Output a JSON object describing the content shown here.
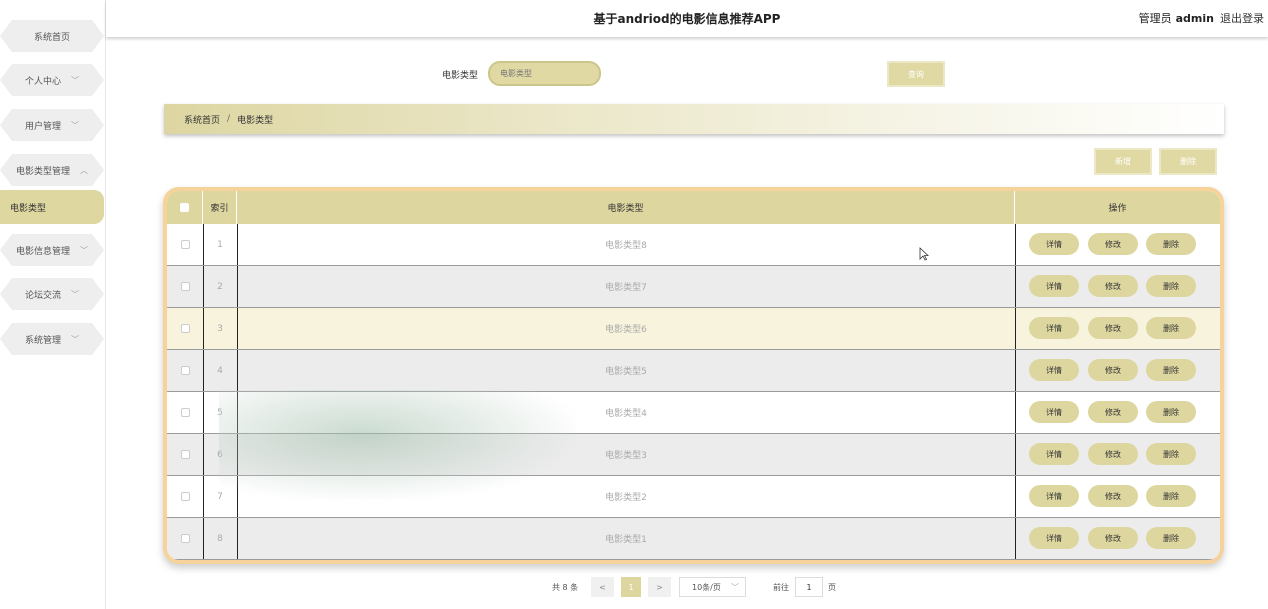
{
  "header": {
    "title": "基于andriod的电影信息推荐APP",
    "role": "管理员",
    "username": "admin",
    "logout": "退出登录"
  },
  "sidebar": {
    "items": [
      {
        "label": "系统首页",
        "chevron": ""
      },
      {
        "label": "个人中心",
        "chevron": "﹀"
      },
      {
        "label": "用户管理",
        "chevron": "﹀"
      },
      {
        "label": "电影类型管理",
        "chevron": "︿"
      },
      {
        "label": "电影类型",
        "chevron": ""
      },
      {
        "label": "电影信息管理",
        "chevron": "﹀"
      },
      {
        "label": "论坛交流",
        "chevron": "﹀"
      },
      {
        "label": "系统管理",
        "chevron": "﹀"
      }
    ]
  },
  "search": {
    "label": "电影类型",
    "placeholder": "电影类型",
    "button": "查询"
  },
  "breadcrumb": {
    "home": "系统首页",
    "separator": "/",
    "current": "电影类型"
  },
  "actions": {
    "add": "新增",
    "delete": "删除"
  },
  "table": {
    "headers": {
      "index": "索引",
      "type": "电影类型",
      "ops": "操作"
    },
    "rows": [
      {
        "index": "1",
        "type": "电影类型8"
      },
      {
        "index": "2",
        "type": "电影类型7"
      },
      {
        "index": "3",
        "type": "电影类型6"
      },
      {
        "index": "4",
        "type": "电影类型5"
      },
      {
        "index": "5",
        "type": "电影类型4"
      },
      {
        "index": "6",
        "type": "电影类型3"
      },
      {
        "index": "7",
        "type": "电影类型2"
      },
      {
        "index": "8",
        "type": "电影类型1"
      }
    ],
    "row_buttons": {
      "detail": "详情",
      "edit": "修改",
      "delete": "删除"
    }
  },
  "pagination": {
    "total": "共 8 条",
    "prev": "<",
    "current_page": "1",
    "next": ">",
    "page_size": "10条/页",
    "goto_label": "前往",
    "goto_value": "1",
    "page_suffix": "页"
  },
  "colors": {
    "accent": "#ddd69f",
    "table_border": "#f5d39a"
  }
}
